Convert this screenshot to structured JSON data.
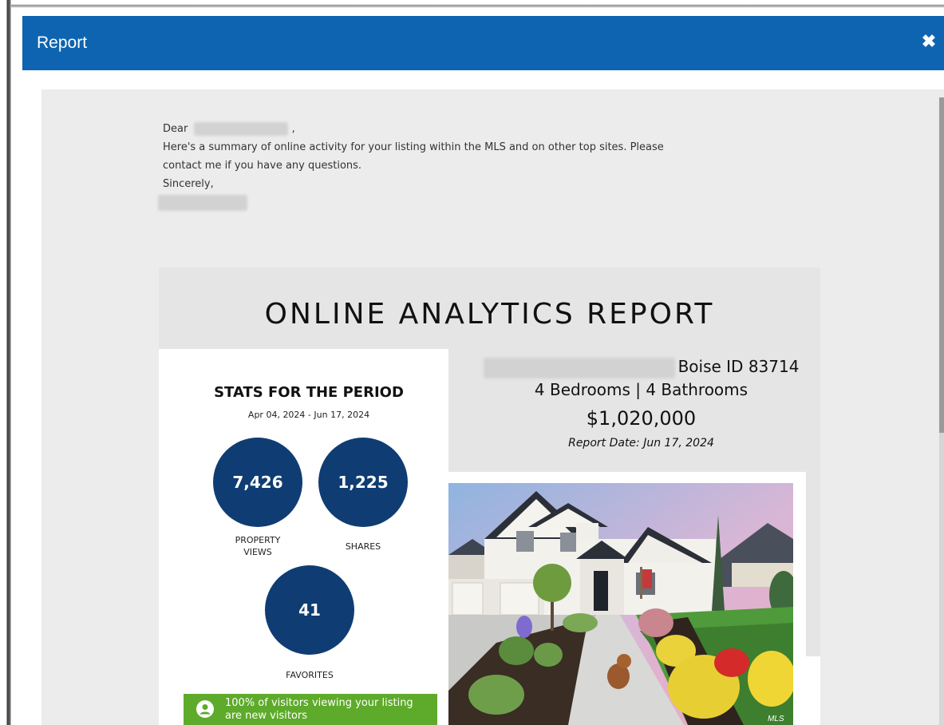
{
  "modal": {
    "title": "Report",
    "close_icon": "close-icon"
  },
  "letter": {
    "greeting": "Dear",
    "greeting_suffix": ",",
    "body_line1": "Here's a summary of online activity for your listing within the MLS and on other top sites. Please",
    "body_line2": "contact me if you have any questions.",
    "closing": "Sincerely,"
  },
  "report": {
    "title": "ONLINE ANALYTICS REPORT",
    "stats": {
      "heading": "STATS FOR THE PERIOD",
      "range": "Apr 04, 2024 - Jun 17, 2024",
      "views": {
        "value": "7,426",
        "label_line1": "PROPERTY",
        "label_line2": "VIEWS"
      },
      "shares": {
        "value": "1,225",
        "label": "SHARES"
      },
      "favorites": {
        "value": "41",
        "label": "FAVORITES"
      },
      "visitors_line1": "100% of visitors viewing your listing",
      "visitors_line2": "are new visitors"
    },
    "property": {
      "city": "Boise ID 83714",
      "details": "4 Bedrooms | 4 Bathrooms",
      "price": "$1,020,000",
      "report_date": "Report Date: Jun 17, 2024",
      "photo_watermark": "MLS"
    }
  },
  "colors": {
    "header": "#0e64b0",
    "circle": "#0f3d73",
    "banner": "#5eaa2a"
  }
}
